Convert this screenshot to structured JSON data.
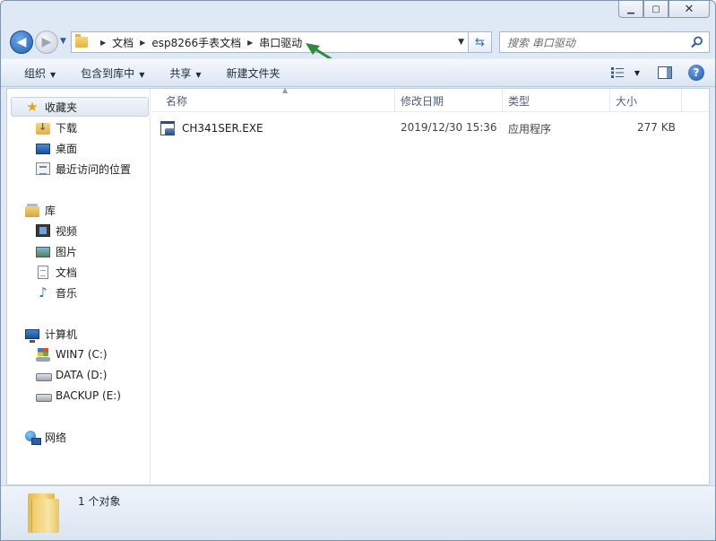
{
  "window": {
    "caption": {
      "minimize": "▁",
      "maximize": "▢",
      "close": "✕"
    }
  },
  "address_bar": {
    "crumbs": [
      "文档",
      "esp8266手表文档",
      "串口驱动"
    ]
  },
  "search": {
    "placeholder": "搜索 串口驱动"
  },
  "toolbar": {
    "organize": "组织",
    "include_in_library": "包含到库中",
    "share": "共享",
    "new_folder": "新建文件夹"
  },
  "sidebar": {
    "favorites": {
      "label": "收藏夹",
      "items": [
        "下载",
        "桌面",
        "最近访问的位置"
      ]
    },
    "libraries": {
      "label": "库",
      "items": [
        "视频",
        "图片",
        "文档",
        "音乐"
      ]
    },
    "computer": {
      "label": "计算机",
      "items": [
        "WIN7 (C:)",
        "DATA (D:)",
        "BACKUP (E:)"
      ]
    },
    "network": {
      "label": "网络"
    }
  },
  "columns": {
    "name": "名称",
    "date": "修改日期",
    "type": "类型",
    "size": "大小"
  },
  "files": [
    {
      "name": "CH341SER.EXE",
      "date": "2019/12/30 15:36",
      "type": "应用程序",
      "size": "277 KB"
    }
  ],
  "details": {
    "count": "1 个对象"
  },
  "colors": {
    "annotation_arrow": "#2e8b3e",
    "accent": "#1f5fb6"
  }
}
